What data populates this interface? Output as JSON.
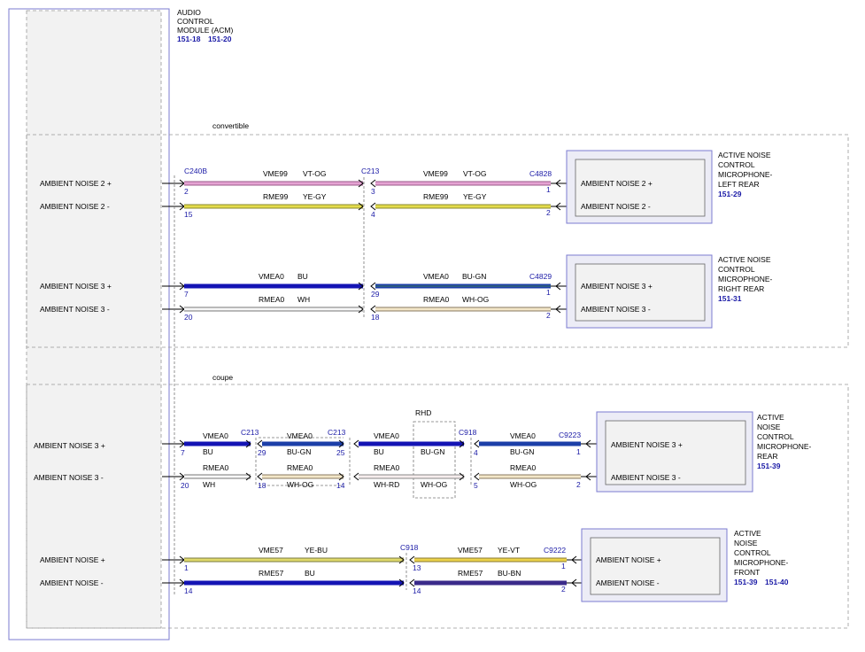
{
  "acm": {
    "title": [
      "AUDIO",
      "CONTROL",
      "MODULE (ACM)"
    ],
    "refs": [
      "151-18",
      "151-20"
    ]
  },
  "sections": {
    "convertible": "convertible",
    "coupe": "coupe"
  },
  "rhd": "RHD",
  "acm_pins": [
    "AMBIENT NOISE 2 +",
    "AMBIENT NOISE 2 -",
    "AMBIENT NOISE 3 +",
    "AMBIENT NOISE 3 -",
    "AMBIENT NOISE 3 +",
    "AMBIENT NOISE 3 -",
    "AMBIENT NOISE +",
    "AMBIENT NOISE -"
  ],
  "connectors": [
    "C240B",
    "C213",
    "C4828",
    "C4829",
    "C213",
    "C213",
    "C918",
    "C9223",
    "C918",
    "C9222"
  ],
  "pin_numbers": [
    "2",
    "15",
    "3",
    "4",
    "1",
    "2",
    "7",
    "20",
    "29",
    "18",
    "1",
    "2",
    "7",
    "20",
    "29",
    "18",
    "25",
    "14",
    "4",
    "5",
    "1",
    "2",
    "1",
    "14",
    "13",
    "14",
    "1",
    "2"
  ],
  "circuits": [
    "VME99",
    "VT-OG",
    "RME99",
    "YE-GY",
    "VME99",
    "VT-OG",
    "RME99",
    "YE-GY",
    "VMEA0",
    "BU",
    "RMEA0",
    "WH",
    "VMEA0",
    "BU-GN",
    "RMEA0",
    "WH-OG",
    "VMEA0",
    "BU",
    "RMEA0",
    "WH",
    "VMEA0",
    "BU-GN",
    "RMEA0",
    "WH-OG",
    "VMEA0",
    "BU",
    "RMEA0",
    "WH-RD",
    "BU-GN",
    "WH-OG",
    "VMEA0",
    "BU-GN",
    "RMEA0",
    "WH-OG",
    "VME57",
    "YE-BU",
    "RME57",
    "BU",
    "VME57",
    "YE-VT",
    "RME57",
    "BU-BN"
  ],
  "mics": [
    {
      "title": [
        "ACTIVE NOISE",
        "CONTROL",
        "MICROPHONE-",
        "LEFT REAR"
      ],
      "refs": [
        "151-29"
      ],
      "pins": [
        "AMBIENT NOISE 2 +",
        "AMBIENT NOISE 2 -"
      ]
    },
    {
      "title": [
        "ACTIVE NOISE",
        "CONTROL",
        "MICROPHONE-",
        "RIGHT REAR"
      ],
      "refs": [
        "151-31"
      ],
      "pins": [
        "AMBIENT NOISE 3 +",
        "AMBIENT NOISE 3 -"
      ]
    },
    {
      "title": [
        "ACTIVE",
        "NOISE",
        "CONTROL",
        "MICROPHONE-",
        "REAR"
      ],
      "refs": [
        "151-39"
      ],
      "pins": [
        "AMBIENT NOISE 3 +",
        "AMBIENT NOISE 3 -"
      ]
    },
    {
      "title": [
        "ACTIVE",
        "NOISE",
        "CONTROL",
        "MICROPHONE-",
        "FRONT"
      ],
      "refs": [
        "151-39",
        "151-40"
      ],
      "pins": [
        "AMBIENT NOISE +",
        "AMBIENT NOISE -"
      ]
    }
  ],
  "wire_colors": {
    "VT-OG": "#d98fc4",
    "YE-GY": "#d6cf3a",
    "BU": "#1414b4",
    "BU-GN": "#1c3fa8",
    "WH": "#f4f4f4",
    "WH-OG": "#f2e6c8",
    "WH-RD": "#f4eaea",
    "YE-BU": "#d8d25a",
    "YE-VT": "#e0cf40",
    "BU-BN": "#3a2a8a"
  }
}
